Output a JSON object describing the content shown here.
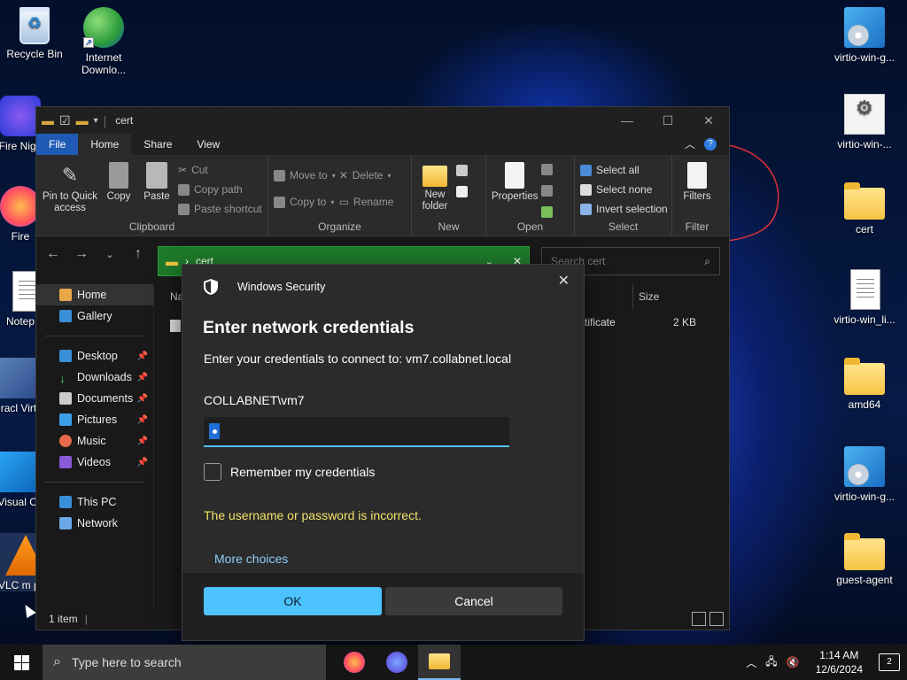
{
  "desktop": {
    "left_icons": [
      {
        "label": "Recycle Bin"
      },
      {
        "label": "Internet Downlo..."
      },
      {
        "label": "Fire Nigh"
      },
      {
        "label": "Fire"
      },
      {
        "label": "Notep"
      },
      {
        "label": "Oracl Virtua"
      },
      {
        "label": "Visual Co"
      },
      {
        "label": "VLC m play"
      }
    ],
    "right_icons": [
      {
        "label": "virtio-win-g..."
      },
      {
        "label": "virtio-win-..."
      },
      {
        "label": "cert"
      },
      {
        "label": "virtio-win_li..."
      },
      {
        "label": "amd64"
      },
      {
        "label": "virtio-win-g..."
      },
      {
        "label": "guest-agent"
      }
    ]
  },
  "explorer": {
    "title": "cert",
    "tabs": [
      "File",
      "Home",
      "Share",
      "View"
    ],
    "ribbon": {
      "clipboard": {
        "label": "Clipboard",
        "pin": "Pin to Quick access",
        "copy": "Copy",
        "paste": "Paste",
        "cut": "Cut",
        "copy_path": "Copy path",
        "paste_shortcut": "Paste shortcut"
      },
      "organize": {
        "label": "Organize",
        "move_to": "Move to",
        "copy_to": "Copy to",
        "delete": "Delete",
        "rename": "Rename"
      },
      "new": {
        "label": "New",
        "new_folder": "New folder"
      },
      "open": {
        "label": "Open",
        "properties": "Properties"
      },
      "select": {
        "label": "Select",
        "select_all": "Select all",
        "select_none": "Select none",
        "invert": "Invert selection"
      },
      "filter": {
        "label": "Filter",
        "filters": "Filters"
      }
    },
    "address": {
      "path": "cert"
    },
    "search": {
      "placeholder": "Search cert"
    },
    "sidebar": {
      "home": "Home",
      "gallery": "Gallery",
      "pinned": [
        "Desktop",
        "Downloads",
        "Documents",
        "Pictures",
        "Music",
        "Videos"
      ],
      "this_pc": "This PC",
      "network": "Network"
    },
    "columns": {
      "name": "Na",
      "size": "Size"
    },
    "file": {
      "type": "tificate",
      "size": "2 KB"
    },
    "status": "1 item"
  },
  "dialog": {
    "app": "Windows Security",
    "title": "Enter network credentials",
    "subtitle": "Enter your credentials to connect to: vm7.collabnet.local",
    "username": "COLLABNET\\vm7",
    "remember": "Remember my credentials",
    "error": "The username or password is incorrect.",
    "more_choices": "More choices",
    "ok": "OK",
    "cancel": "Cancel"
  },
  "taskbar": {
    "search_placeholder": "Type here to search",
    "time": "1:14 AM",
    "date": "12/6/2024",
    "notifications": "2"
  },
  "colors": {
    "accent": "#4cc2ff",
    "error": "#f3e06a",
    "link": "#8ecdf7",
    "address_bg": "#1e7a2a",
    "annotation": "#e0303a"
  }
}
